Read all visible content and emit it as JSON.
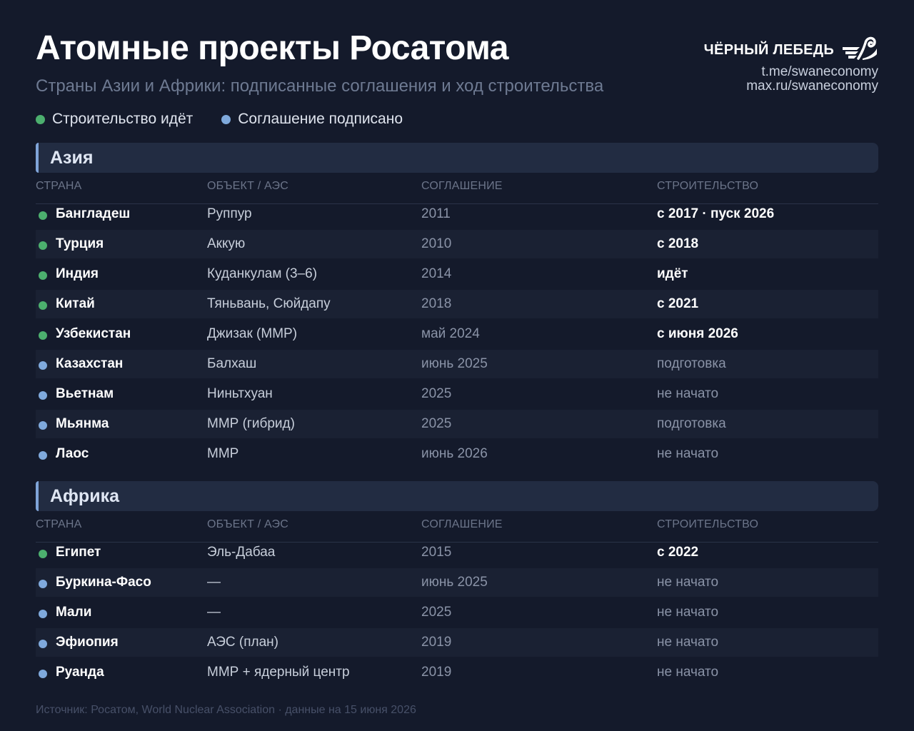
{
  "header": {
    "title": "Атомные проекты Росатома",
    "subtitle": "Страны Азии и Африки: подписанные соглашения и ход строительства"
  },
  "brand": {
    "name": "ЧЁРНЫЙ ЛЕБЕДЬ",
    "icon": "swan-logo-icon",
    "link1": "t.me/swaneconomy",
    "link2": "max.ru/swaneconomy"
  },
  "legend": {
    "construction": "Строительство идёт",
    "agreement": "Соглашение подписано"
  },
  "colors": {
    "construction": "#4caf6e",
    "agreement": "#7fa9dc",
    "accent": "#7fa4d8"
  },
  "columns": {
    "country": "СТРАНА",
    "object": "ОБЪЕКТ / АЭС",
    "agreement": "СОГЛАШЕНИЕ",
    "construction": "СТРОИТЕЛЬСТВО"
  },
  "asia": {
    "title": "Азия",
    "rows": [
      {
        "status": "construction",
        "country": "Бангладеш",
        "object": "Руппур",
        "agreement": "2011",
        "construction": "с 2017 · пуск 2026"
      },
      {
        "status": "construction",
        "country": "Турция",
        "object": "Аккую",
        "agreement": "2010",
        "construction": "с 2018"
      },
      {
        "status": "construction",
        "country": "Индия",
        "object": "Куданкулам (3–6)",
        "agreement": "2014",
        "construction": "идёт"
      },
      {
        "status": "construction",
        "country": "Китай",
        "object": "Тяньвань, Сюйдапу",
        "agreement": "2018",
        "construction": "с 2021"
      },
      {
        "status": "construction",
        "country": "Узбекистан",
        "object": "Джизак (ММР)",
        "agreement": "май 2024",
        "construction": "с июня 2026"
      },
      {
        "status": "agreement",
        "country": "Казахстан",
        "object": "Балхаш",
        "agreement": "июнь 2025",
        "construction": "подготовка"
      },
      {
        "status": "agreement",
        "country": "Вьетнам",
        "object": "Ниньтхуан",
        "agreement": "2025",
        "construction": "не начато"
      },
      {
        "status": "agreement",
        "country": "Мьянма",
        "object": "ММР (гибрид)",
        "agreement": "2025",
        "construction": "подготовка"
      },
      {
        "status": "agreement",
        "country": "Лаос",
        "object": "ММР",
        "agreement": "июнь 2026",
        "construction": "не начато"
      }
    ]
  },
  "africa": {
    "title": "Африка",
    "rows": [
      {
        "status": "construction",
        "country": "Египет",
        "object": "Эль-Дабаа",
        "agreement": "2015",
        "construction": "с 2022"
      },
      {
        "status": "agreement",
        "country": "Буркина-Фасо",
        "object": "—",
        "agreement": "июнь 2025",
        "construction": "не начато"
      },
      {
        "status": "agreement",
        "country": "Мали",
        "object": "—",
        "agreement": "2025",
        "construction": "не начато"
      },
      {
        "status": "agreement",
        "country": "Эфиопия",
        "object": "АЭС (план)",
        "agreement": "2019",
        "construction": "не начато"
      },
      {
        "status": "agreement",
        "country": "Руанда",
        "object": "ММР + ядерный центр",
        "agreement": "2019",
        "construction": "не начато"
      }
    ]
  },
  "footer": {
    "source": "Источник: Росатом, World Nuclear Association · данные на 15 июня 2026"
  }
}
